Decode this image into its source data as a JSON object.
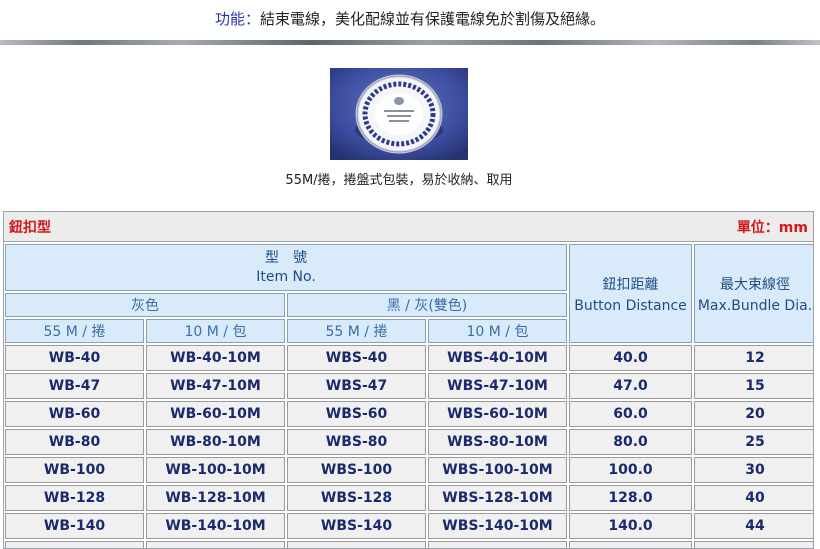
{
  "function_line": {
    "label": "功能",
    "separator": "：",
    "text": "結束電線，美化配線並有保護電線免於割傷及絕緣。"
  },
  "product_image": {
    "icon": "cable-tie-reel-photo"
  },
  "caption": "55M/捲，捲盤式包裝，易於收納、取用",
  "table": {
    "category": "鈕扣型",
    "unit": "單位：mm",
    "header": {
      "model_zh": "型　號",
      "model_en": "Item No.",
      "gray": "灰色",
      "black_gray": "黑 / 灰(雙色)",
      "sub": [
        "55 M / 捲",
        "10 M / 包",
        "55 M / 捲",
        "10 M / 包"
      ],
      "button_distance_zh": "鈕扣距離",
      "button_distance_en": "Button Distance",
      "max_bundle_zh": "最大束線徑",
      "max_bundle_en": "Max.Bundle Dia."
    },
    "rows": [
      [
        "WB-40",
        "WB-40-10M",
        "WBS-40",
        "WBS-40-10M",
        "40.0",
        "12"
      ],
      [
        "WB-47",
        "WB-47-10M",
        "WBS-47",
        "WBS-47-10M",
        "47.0",
        "15"
      ],
      [
        "WB-60",
        "WB-60-10M",
        "WBS-60",
        "WBS-60-10M",
        "60.0",
        "20"
      ],
      [
        "WB-80",
        "WB-80-10M",
        "WBS-80",
        "WBS-80-10M",
        "80.0",
        "25"
      ],
      [
        "WB-100",
        "WB-100-10M",
        "WBS-100",
        "WBS-100-10M",
        "100.0",
        "30"
      ],
      [
        "WB-128",
        "WB-128-10M",
        "WBS-128",
        "WBS-128-10M",
        "128.0",
        "40"
      ],
      [
        "WB-140",
        "WB-140-10M",
        "WBS-140",
        "WBS-140-10M",
        "140.0",
        "44"
      ],
      [
        "",
        "",
        "",
        "",
        "",
        ""
      ]
    ]
  }
}
